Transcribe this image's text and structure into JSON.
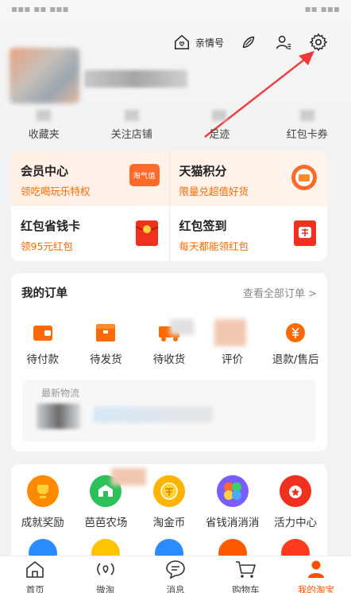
{
  "top": {
    "family_label": "亲情号"
  },
  "stats": [
    {
      "label": "收藏夹"
    },
    {
      "label": "关注店铺"
    },
    {
      "label": "足迹"
    },
    {
      "label": "红包卡券"
    }
  ],
  "benefits": [
    {
      "title": "会员中心",
      "subtitle": "领吃喝玩乐特权",
      "badge": "淘气值"
    },
    {
      "title": "天猫积分",
      "subtitle": "限量兑超值好货"
    },
    {
      "title": "红包省钱卡",
      "subtitle": "领95元红包"
    },
    {
      "title": "红包签到",
      "subtitle": "每天都能领红包"
    }
  ],
  "orders": {
    "title": "我的订单",
    "view_all": "查看全部订单 >",
    "items": [
      {
        "label": "待付款"
      },
      {
        "label": "待发货"
      },
      {
        "label": "待收货"
      },
      {
        "label": "评价"
      },
      {
        "label": "退款/售后"
      }
    ],
    "logistics_label": "最新物流"
  },
  "tools": [
    {
      "label": "成就奖励"
    },
    {
      "label": "芭芭农场"
    },
    {
      "label": "淘金币"
    },
    {
      "label": "省钱消消消"
    },
    {
      "label": "活力中心"
    }
  ],
  "tabbar": [
    {
      "label": "首页"
    },
    {
      "label": "微淘"
    },
    {
      "label": "消息"
    },
    {
      "label": "购物车"
    },
    {
      "label": "我的淘宝"
    }
  ],
  "colors": {
    "accent": "#ff5000",
    "orange_text": "#ff6a00"
  }
}
